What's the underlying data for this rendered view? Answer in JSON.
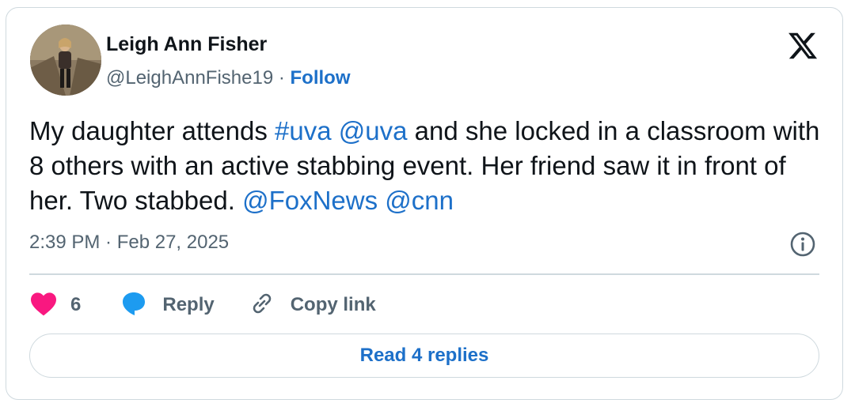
{
  "author": {
    "name": "Leigh Ann Fisher",
    "handle": "@LeighAnnFishe19",
    "separator": " · ",
    "follow_label": "Follow"
  },
  "tweet": {
    "segments": [
      {
        "text": "My daughter attends ",
        "link": false
      },
      {
        "text": "#uva",
        "link": true
      },
      {
        "text": " ",
        "link": false
      },
      {
        "text": "@uva",
        "link": true
      },
      {
        "text": " and she locked in a classroom with 8 others with an active stabbing event. Her friend saw it in front of her. Two stabbed. ",
        "link": false
      },
      {
        "text": "@FoxNews",
        "link": true
      },
      {
        "text": " ",
        "link": false
      },
      {
        "text": "@cnn",
        "link": true
      }
    ],
    "timestamp": "2:39 PM · Feb 27, 2025"
  },
  "actions": {
    "like_count": "6",
    "reply_label": "Reply",
    "copy_link_label": "Copy link"
  },
  "read_replies_label": "Read 4 replies",
  "colors": {
    "link": "#1d70c9",
    "like": "#f91880",
    "reply_icon": "#1d9bf0",
    "muted": "#536471",
    "border": "#cfd9de"
  },
  "icons": [
    "x-logo-icon",
    "info-icon",
    "heart-icon",
    "reply-bubble-icon",
    "link-icon"
  ]
}
